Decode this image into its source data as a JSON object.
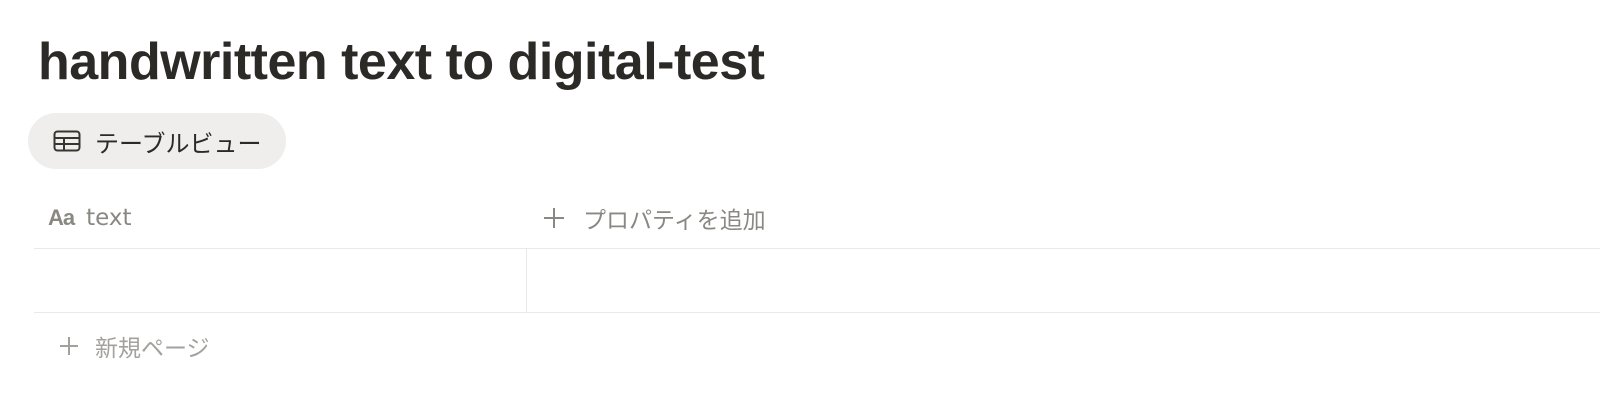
{
  "page": {
    "title": "handwritten text to digital-test"
  },
  "views": [
    {
      "label": "テーブルビュー",
      "icon": "table-icon",
      "active": true
    }
  ],
  "table": {
    "columns": [
      {
        "type_icon_label": "Aa",
        "icon": "text-type-icon",
        "name": "text"
      }
    ],
    "add_property_label": "プロパティを追加",
    "rows": [
      {
        "text": ""
      }
    ],
    "new_page_label": "新規ページ"
  },
  "colors": {
    "title": "#2b2a27",
    "muted_text": "#8a8883",
    "faint_text": "#a3a19d",
    "tab_background": "#efeeec",
    "divider": "#e9e9e7"
  }
}
